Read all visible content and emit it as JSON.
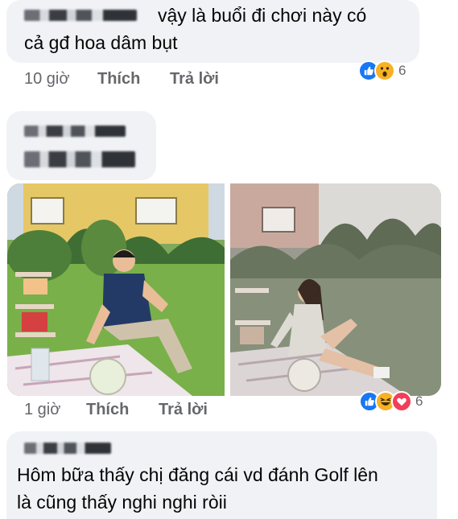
{
  "comments": [
    {
      "text": "vậy là buổi đi chơi này có\ncả gđ hoa dâm bụt",
      "line1": "vậy là buổi đi chơi này có",
      "line2": "cả gđ hoa dâm bụt",
      "time": "10 giờ",
      "like_label": "Thích",
      "reply_label": "Trả lời",
      "reactions": [
        "like-icon",
        "wow-icon"
      ],
      "reaction_count": "6"
    },
    {
      "time": "1 giờ",
      "like_label": "Thích",
      "reply_label": "Trả lời",
      "reactions": [
        "like-icon",
        "haha-icon",
        "love-icon"
      ],
      "reaction_count": "6"
    },
    {
      "line1": "Hôm bữa thấy chị đăng cái vd đánh Golf lên",
      "line2": "là cũng thấy nghi nghi ròii"
    }
  ],
  "colors": {
    "bubble": "#f0f2f5",
    "meta_text": "#65676b",
    "like_blue": "#1877f2",
    "love_red": "#f33e58",
    "emoji_yellow": "#f7b125"
  }
}
